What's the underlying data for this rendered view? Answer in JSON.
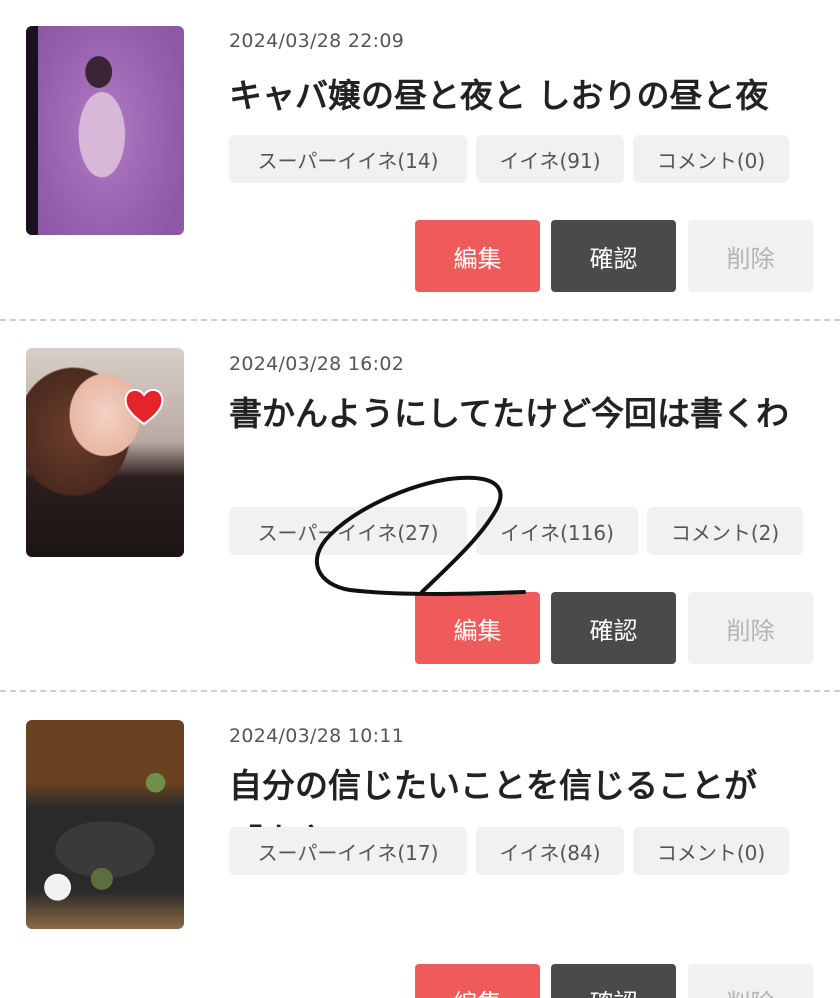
{
  "posts": [
    {
      "date": "2024/03/28 22:09",
      "title": "キャバ嬢の昼と夜と しおりの昼と夜",
      "tags": {
        "super_like": "スーパーイイネ(14)",
        "like": "イイネ(91)",
        "comment": "コメント(0)"
      },
      "buttons": {
        "edit": "編集",
        "confirm": "確認",
        "delete": "削除"
      }
    },
    {
      "date": "2024/03/28 16:02",
      "title": "書かんようにしてたけど今回は書くわ",
      "tags": {
        "super_like": "スーパーイイネ(27)",
        "like": "イイネ(116)",
        "comment": "コメント(2)"
      },
      "buttons": {
        "edit": "編集",
        "confirm": "確認",
        "delete": "削除"
      }
    },
    {
      "date": "2024/03/28 10:11",
      "title": "自分の信じたいことを信じることが「真実」",
      "tags": {
        "super_like": "スーパーイイネ(17)",
        "like": "イイネ(84)",
        "comment": "コメント(0)"
      },
      "buttons": {
        "edit": "編集",
        "confirm": "確認",
        "delete": "削除"
      }
    }
  ],
  "colors": {
    "edit": "#ef5a5a",
    "confirm": "#4a4a4a",
    "delete_bg": "#f1f1f1",
    "tag_bg": "#f1f1f1"
  }
}
